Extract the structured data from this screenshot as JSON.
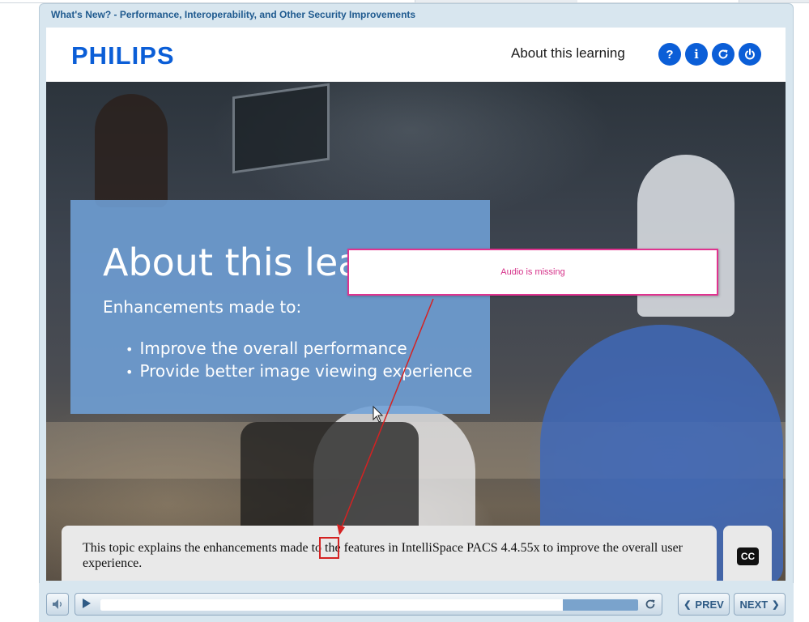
{
  "course": {
    "title": "What's New? - Performance, Interoperability, and Other Security Improvements"
  },
  "header": {
    "logo_text": "PHILIPS",
    "about_link": "About this learning",
    "buttons": [
      {
        "name": "help",
        "icon": "question-icon",
        "label": "?"
      },
      {
        "name": "info",
        "icon": "info-icon",
        "label": "i"
      },
      {
        "name": "restart",
        "icon": "restart-icon"
      },
      {
        "name": "exit",
        "icon": "power-icon"
      }
    ],
    "brand_color": "#0b5ed7"
  },
  "slide": {
    "heading": "About this lea",
    "subheading": "Enhancements made to:",
    "bullets": [
      "Improve the overall performance",
      "Provide better image viewing experience"
    ],
    "panel_color": "#70a0d7"
  },
  "review": {
    "callout_text": "Audio is missing",
    "callout_color": "#e0338f",
    "arrow_color": "#d42222"
  },
  "caption": {
    "text": "This topic explains the enhancements made to the features in IntelliSpace PACS 4.4.55x to improve the overall user experience.",
    "highlighted_word": "to"
  },
  "cc_button": {
    "label": "CC"
  },
  "controls": {
    "prev_label": "PREV",
    "next_label": "NEXT",
    "progress": 0.86,
    "icons": [
      "speaker-icon",
      "play-icon",
      "replay-icon",
      "chevron-left-icon",
      "chevron-right-icon"
    ]
  }
}
